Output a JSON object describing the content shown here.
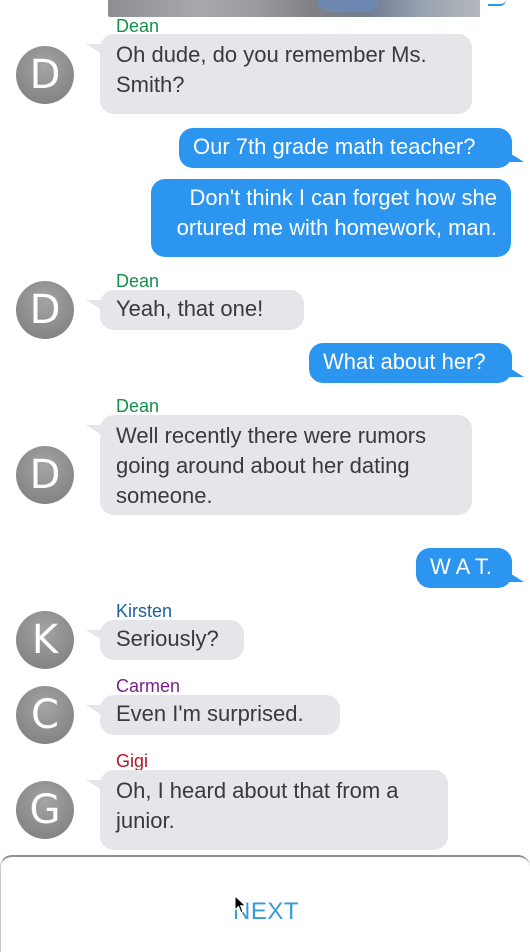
{
  "colors": {
    "incoming_bubble": "#e5e5ea",
    "outgoing_bubble": "#2b95f0",
    "avatar": "#8d8d8d",
    "next_button": "#3a9ad9"
  },
  "messages": [
    {
      "direction": "in",
      "sender": "Dean",
      "sender_color": "#13904a",
      "avatar_letter": "D",
      "lines": [
        "Oh dude, do you remember Ms.",
        "Smith?"
      ]
    },
    {
      "direction": "out",
      "lines": [
        "Our 7th grade math teacher?"
      ]
    },
    {
      "direction": "out",
      "lines": [
        "Don't think I can forget how she",
        "ortured me with homework, man."
      ]
    },
    {
      "direction": "in",
      "sender": "Dean",
      "sender_color": "#13904a",
      "avatar_letter": "D",
      "lines": [
        "Yeah, that one!"
      ]
    },
    {
      "direction": "out",
      "lines": [
        "What about her?"
      ]
    },
    {
      "direction": "in",
      "sender": "Dean",
      "sender_color": "#13904a",
      "avatar_letter": "D",
      "lines": [
        "Well recently there were rumors",
        "going around about her dating",
        "someone."
      ]
    },
    {
      "direction": "out",
      "lines": [
        "W A T."
      ]
    },
    {
      "direction": "in",
      "sender": "Kirsten",
      "sender_color": "#1f5fa0",
      "avatar_letter": "K",
      "lines": [
        "Seriously?"
      ]
    },
    {
      "direction": "in",
      "sender": "Carmen",
      "sender_color": "#7b1f8f",
      "avatar_letter": "C",
      "lines": [
        "Even I'm surprised."
      ]
    },
    {
      "direction": "in",
      "sender": "Gigi",
      "sender_color": "#b0182a",
      "avatar_letter": "G",
      "lines": [
        "Oh, I heard about that from a",
        "junior."
      ]
    }
  ],
  "footer": {
    "next_label": "NEXT"
  }
}
